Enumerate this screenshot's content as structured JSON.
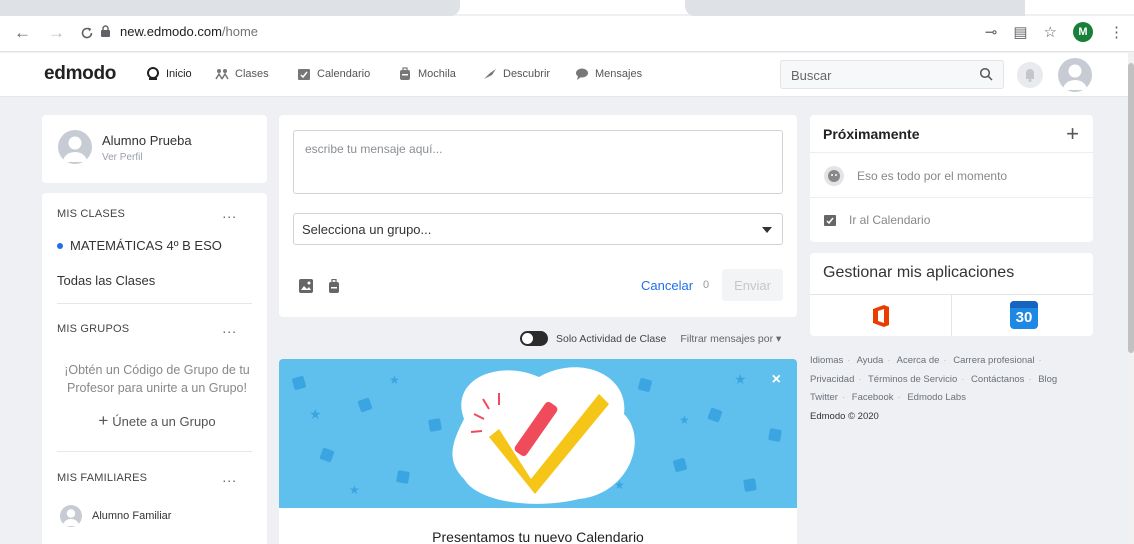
{
  "browser": {
    "url_host": "new.edmodo.com",
    "url_path": "/home",
    "profile_initial": "M"
  },
  "nav": {
    "logo": "edmodo",
    "items": [
      {
        "label": "Inicio"
      },
      {
        "label": "Clases"
      },
      {
        "label": "Calendario"
      },
      {
        "label": "Mochila"
      },
      {
        "label": "Descubrir"
      },
      {
        "label": "Mensajes"
      }
    ],
    "search_placeholder": "Buscar"
  },
  "profile": {
    "name": "Alumno Prueba",
    "link": "Ver Perfil"
  },
  "sidebar": {
    "classes_title": "MIS CLASES",
    "classes": [
      {
        "label": "MATEMÁTICAS 4º B ESO"
      }
    ],
    "all_classes": "Todas las Clases",
    "groups_title": "MIS GRUPOS",
    "groups_hint": "¡Obtén un Código de Grupo de tu Profesor para unirte a un Grupo!",
    "join_group": "Únete a un Grupo",
    "family_title": "MIS FAMILIARES",
    "family_member": "Alumno Familiar",
    "more": "..."
  },
  "composer": {
    "message_placeholder": "escribe tu mensaje aquí...",
    "group_select": "Selecciona un grupo...",
    "cancel": "Cancelar",
    "char_count": "0",
    "send": "Enviar"
  },
  "feed": {
    "toggle_label": "Solo Actividad de Clase",
    "filter_label": "Filtrar mensajes por",
    "banner_title": "Presentamos tu nuevo Calendario",
    "close": "×"
  },
  "upcoming": {
    "title": "Próximamente",
    "add": "+",
    "empty": "Eso es todo por el momento",
    "calendar_link": "Ir al Calendario"
  },
  "apps": {
    "title": "Gestionar mis aplicaciones",
    "calendar_day": "30"
  },
  "footer": {
    "links": [
      "Idiomas",
      "Ayuda",
      "Acerca de",
      "Carrera profesional",
      "Privacidad",
      "Términos de Servicio",
      "Contáctanos",
      "Blog",
      "Twitter",
      "Facebook",
      "Edmodo Labs"
    ],
    "copyright": "Edmodo © 2020"
  },
  "colors": {
    "accent": "#1f6feb",
    "banner_bg": "#5fc0ee",
    "office_red": "#eb3c00",
    "calendar_blue": "#1e88e5"
  }
}
